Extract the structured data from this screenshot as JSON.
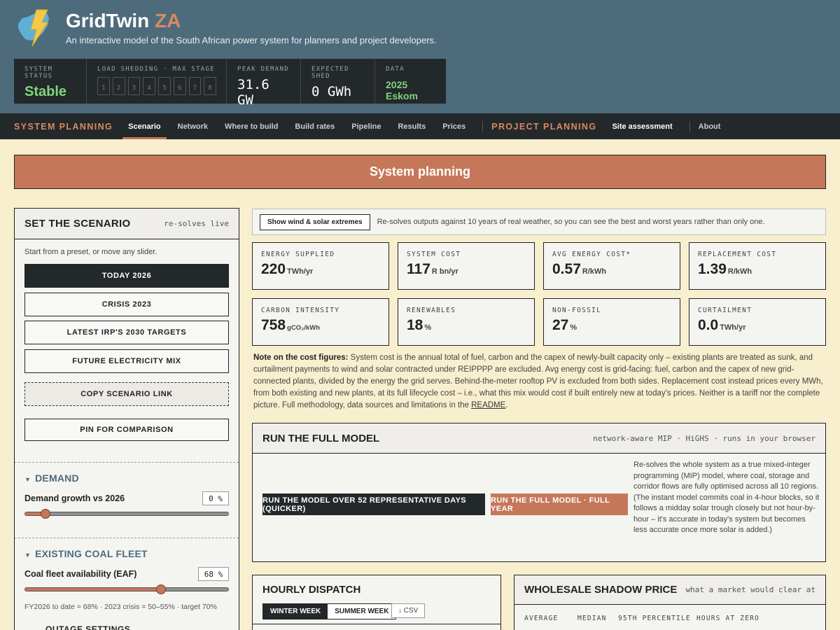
{
  "header": {
    "title_main": "GridTwin",
    "title_accent": "ZA",
    "subtitle": "An interactive model of the South African power system for planners and project developers."
  },
  "status": {
    "system_status_label": "SYSTEM STATUS",
    "system_status_value": "Stable",
    "load_shedding_label": "LOAD SHEDDING · MAX STAGE",
    "stages": [
      "1",
      "2",
      "3",
      "4",
      "5",
      "6",
      "7",
      "8"
    ],
    "peak_demand_label": "PEAK DEMAND",
    "peak_demand_value": "31.6 GW",
    "expected_shed_label": "EXPECTED SHED",
    "expected_shed_value": "0 GWh",
    "data_label": "DATA",
    "data_value": "2025 Eskom"
  },
  "nav": {
    "system_planning": "SYSTEM PLANNING",
    "items": [
      "Scenario",
      "Network",
      "Where to build",
      "Build rates",
      "Pipeline",
      "Results",
      "Prices"
    ],
    "project_planning": "PROJECT PLANNING",
    "site_assessment": "Site assessment",
    "about": "About"
  },
  "banner": {
    "title": "System planning"
  },
  "scenario": {
    "title": "SET THE SCENARIO",
    "hint": "re-solves live",
    "intro": "Start from a preset, or move any slider.",
    "presets": [
      "TODAY 2026",
      "CRISIS 2023",
      "LATEST IRP'S 2030 TARGETS",
      "FUTURE ELECTRICITY MIX"
    ],
    "copy_link": "COPY SCENARIO LINK",
    "pin": "PIN FOR COMPARISON",
    "demand_section": "DEMAND",
    "demand_label": "Demand growth vs 2026",
    "demand_value": "0 %",
    "demand_fraction": 0.1,
    "coal_section": "EXISTING COAL FLEET",
    "coal_label": "Coal fleet availability (EAF)",
    "coal_value": "68 %",
    "coal_fraction": 0.67,
    "coal_note": "FY2026 to date = 68% · 2023 crisis = 50–55% · target 70%",
    "outage_settings": "OUTAGE SETTINGS"
  },
  "extremes": {
    "button": "Show wind & solar extremes",
    "text": "Re-solves outputs against 10 years of real weather, so you can see the best and worst years rather than only one."
  },
  "metrics": [
    {
      "label": "ENERGY SUPPLIED",
      "value": "220",
      "unit": "TWh/yr"
    },
    {
      "label": "SYSTEM COST",
      "value": "117",
      "unit": "R bn/yr"
    },
    {
      "label": "AVG ENERGY COST*",
      "value": "0.57",
      "unit": "R/kWh"
    },
    {
      "label": "REPLACEMENT COST",
      "value": "1.39",
      "unit": "R/kWh"
    },
    {
      "label": "CARBON INTENSITY",
      "value": "758",
      "unit": "gCO₂/kWh"
    },
    {
      "label": "RENEWABLES",
      "value": "18",
      "unit": "%"
    },
    {
      "label": "NON-FOSSIL",
      "value": "27",
      "unit": "%"
    },
    {
      "label": "CURTAILMENT",
      "value": "0.0",
      "unit": "TWh/yr"
    }
  ],
  "note": {
    "lead": "Note on the cost figures:",
    "body": " System cost is the annual total of fuel, carbon and the capex of newly-built capacity only – existing plants are treated as sunk, and curtailment payments to wind and solar contracted under REIPPPP are excluded. Avg energy cost is grid-facing: fuel, carbon and the capex of new grid-connected plants, divided by the energy the grid serves. Behind-the-meter rooftop PV is excluded from both sides. Replacement cost instead prices every MWh, from both existing and new plants, at its full lifecycle cost – i.e., what this mix would cost if built entirely new at today's prices. Neither is a tariff nor the complete picture. Full methodology, data sources and limitations in the ",
    "link": "README",
    "tail": "."
  },
  "run_model": {
    "title": "RUN THE FULL MODEL",
    "hint": "network-aware MIP · HiGHS · runs in your browser",
    "btn_quick": "RUN THE MODEL OVER 52 REPRESENTATIVE DAYS (QUICKER)",
    "btn_full": "RUN THE FULL MODEL · FULL YEAR",
    "description": "Re-solves the whole system as a true mixed-integer programming (MIP) model, where coal, storage and corridor flows are fully optimised across all 10 regions. (The instant model commits coal in 4-hour blocks, so it follows a midday solar trough closely but not hour-by-hour – it's accurate in today's system but becomes less accurate once more solar is added.)"
  },
  "dispatch": {
    "title": "HOURLY DISPATCH",
    "winter": "WINTER WEEK",
    "summer": "SUMMER WEEK",
    "csv": "↓ CSV"
  },
  "wholesale": {
    "title": "WHOLESALE SHADOW PRICE",
    "hint": "what a market would clear at",
    "stats": [
      "AVERAGE",
      "MEDIAN",
      "95TH PERCENTILE",
      "HOURS AT ZERO"
    ]
  },
  "colors": {
    "header_bg": "#4e6b7c",
    "dark": "#23282b",
    "accent": "#c5775a",
    "page_bg": "#f8efcf",
    "status_green": "#7fd67a"
  }
}
